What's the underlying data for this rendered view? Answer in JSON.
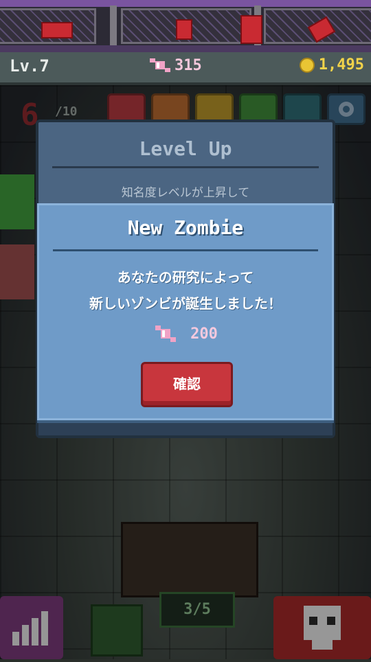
{
  "status": {
    "level": "Lv.7",
    "candy": "315",
    "coins": "1,495"
  },
  "hud": {
    "zombie_count": "6",
    "zombie_capacity": "/10",
    "machine_counter": "3/5"
  },
  "icons": {
    "candy": "candy-icon",
    "coin": "coin-icon",
    "gear": "gear-icon",
    "stats": "bar-chart-icon",
    "zombie": "zombie-face-icon"
  },
  "dialog": {
    "title": "Level Up",
    "subtitle": "知名度レベルが上昇して",
    "inner_title": "New Zombie",
    "message_line1": "あなたの研究によって",
    "message_line2": "新しいゾンビが誕生しました！",
    "reward_amount": "200",
    "confirm_label": "確認"
  },
  "colors": {
    "candy": "#f5c8dc",
    "coin": "#e9c534",
    "confirm": "#c8363d",
    "panel": "#6f9bc8"
  }
}
